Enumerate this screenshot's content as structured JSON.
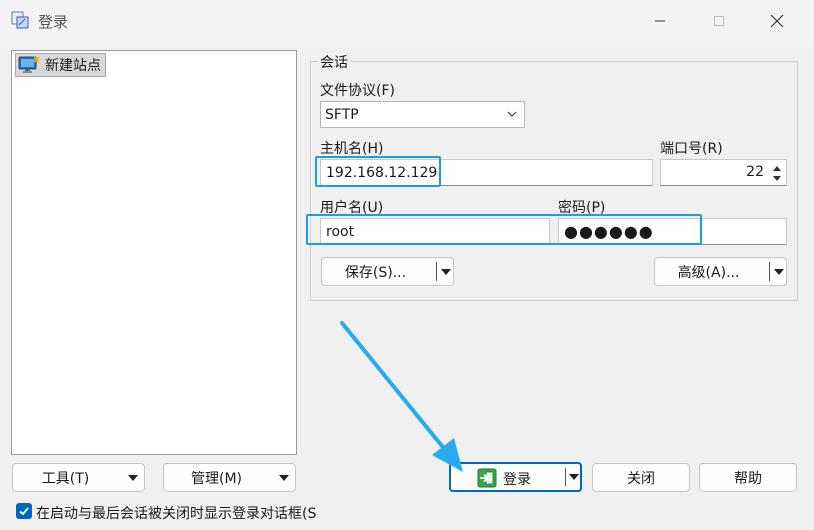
{
  "window": {
    "title": "登录"
  },
  "tree": {
    "items": [
      {
        "label": "新建站点",
        "icon": "monitor-new-site-icon"
      }
    ]
  },
  "session": {
    "group_label": "会话",
    "protocol_label": "文件协议(F)",
    "protocol_value": "SFTP",
    "host_label": "主机名(H)",
    "host_value": "192.168.12.129",
    "port_label": "端口号(R)",
    "port_value": "22",
    "user_label": "用户名(U)",
    "user_value": "root",
    "password_label": "密码(P)",
    "password_value": "●●●●●●",
    "save_label": "保存(S)...",
    "advanced_label": "高级(A)..."
  },
  "bottom": {
    "tools_label": "工具(T)",
    "manage_label": "管理(M)",
    "login_label": "登录",
    "close_label": "关闭",
    "help_label": "帮助",
    "checkbox_label": "在启动与最后会话被关闭时显示登录对话框(S",
    "checkbox_checked": true
  },
  "colors": {
    "highlight": "#1e9be8",
    "primary_border": "#0067c0",
    "annotation_arrow": "#29a9f0"
  }
}
